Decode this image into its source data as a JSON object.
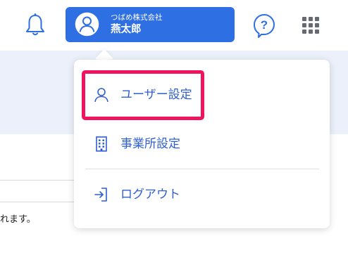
{
  "header": {
    "bell_icon": "bell-icon",
    "help_icon": "help-bubble-icon",
    "apps_icon": "apps-grid-icon",
    "user": {
      "company": "つばめ株式会社",
      "name": "燕太郎",
      "avatar_icon": "user-avatar-icon"
    }
  },
  "background": {
    "text_fragment": "れます。"
  },
  "menu": {
    "items": [
      {
        "label": "ユーザー設定",
        "icon": "person-icon"
      },
      {
        "label": "事業所設定",
        "icon": "building-icon"
      },
      {
        "label": "ログアウト",
        "icon": "logout-icon"
      }
    ]
  },
  "colors": {
    "accent": "#2f6fe4",
    "menu_text": "#2f5fd0",
    "highlight": "#f0145e",
    "background_band": "#ebf0fa"
  }
}
